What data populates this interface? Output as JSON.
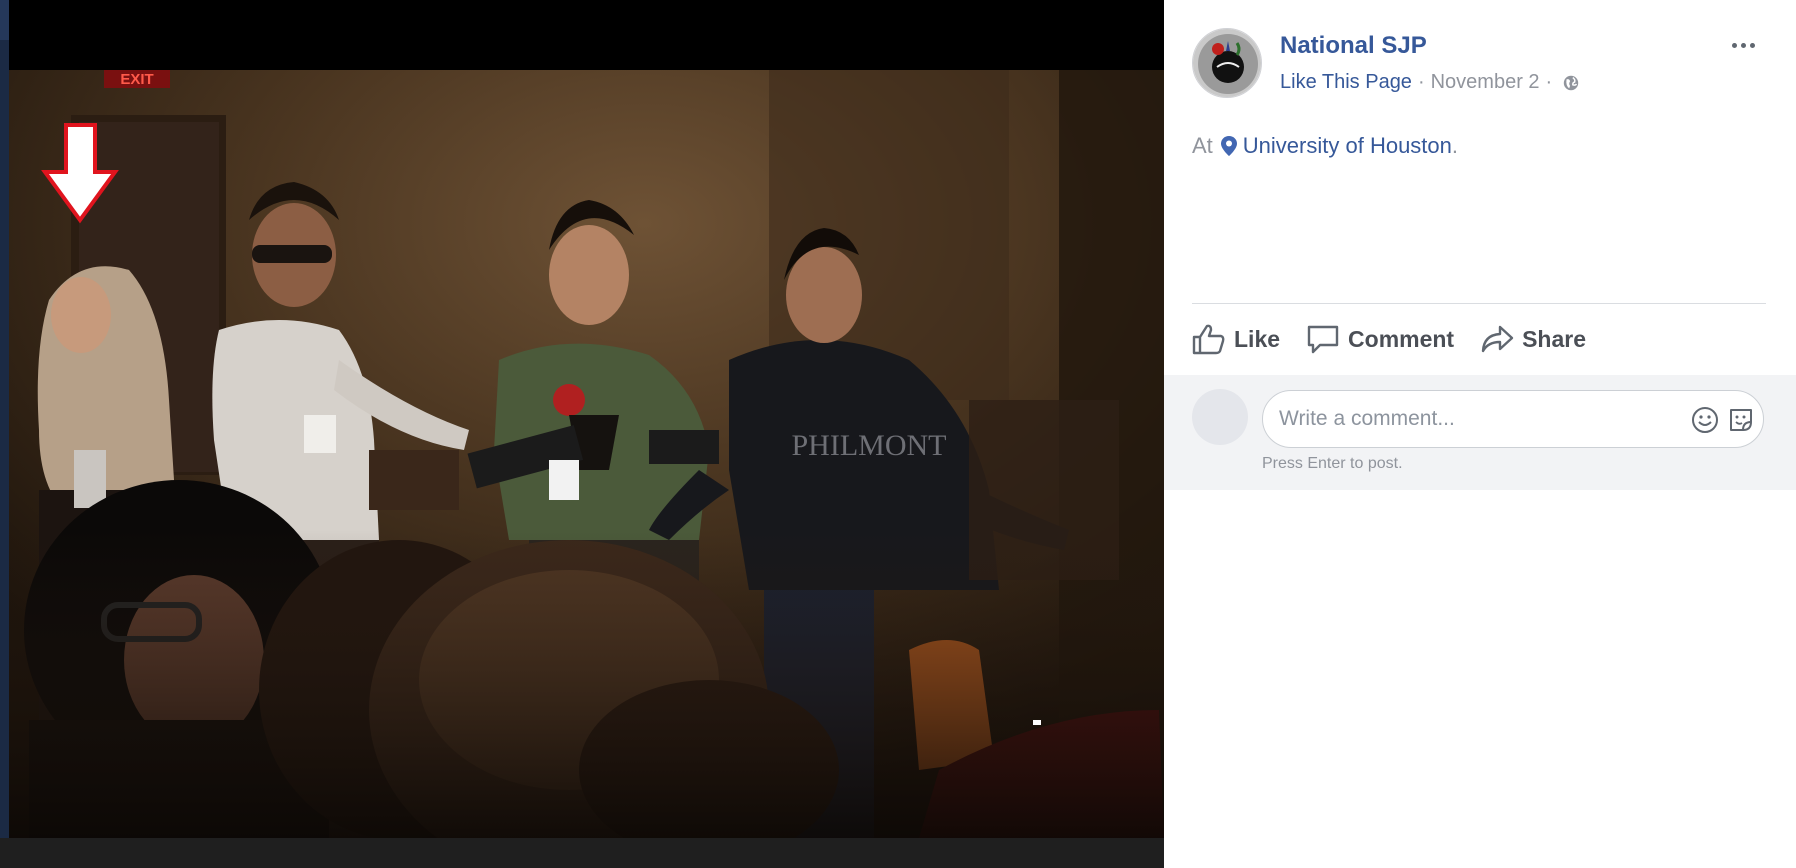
{
  "post": {
    "page_name": "National SJP",
    "like_page": "Like This Page",
    "separator": "·",
    "date": "November 2",
    "location_prefix": "At",
    "location_name": "University of Houston",
    "location_suffix": "."
  },
  "photo": {
    "exit_sign_text": "EXIT",
    "shirt_text": "PHILMONT",
    "arrow_color": "#e0141e",
    "arrow_fill": "#ffffff"
  },
  "actions": {
    "like_label": "Like",
    "comment_label": "Comment",
    "share_label": "Share"
  },
  "comment_box": {
    "placeholder": "Write a comment...",
    "hint": "Press Enter to post."
  },
  "icons": {
    "more": "more-options-icon",
    "globe": "globe-icon",
    "pin": "location-pin-icon",
    "like": "thumbs-up-icon",
    "comment": "speech-bubble-icon",
    "share": "share-arrow-icon",
    "emoji": "smiley-icon",
    "sticker": "sticker-icon"
  },
  "colors": {
    "link": "#365899",
    "meta_text": "#90949c",
    "action_text": "#4b4f56"
  }
}
